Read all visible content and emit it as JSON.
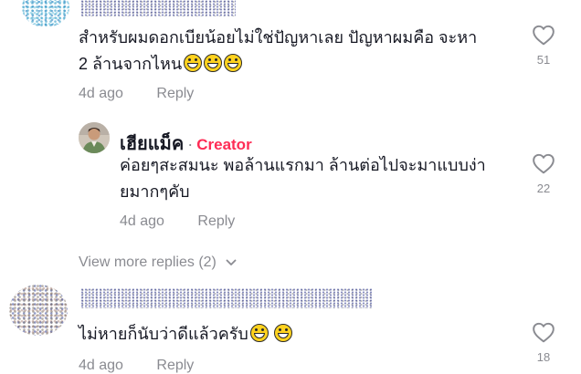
{
  "comments": [
    {
      "text_line1": "สำหรับผมดอกเบียน้อยไม่ใช่ปัญหาเลย ปัญหาผมคือ จะหา",
      "text_line2": "2 ล้านจากไหน",
      "emoji_count": 3,
      "time": "4d ago",
      "reply_label": "Reply",
      "likes": "51"
    },
    {
      "text_line1": "ไม่หายก็นับว่าดีแล้วครับ",
      "emoji_count": 2,
      "time": "4d ago",
      "reply_label": "Reply",
      "likes": "18"
    }
  ],
  "reply": {
    "author": "เฮียแม็ค",
    "separator": "·",
    "badge": "Creator",
    "text_line1": "ค่อยๆสะสมนะ พอล้านแรกมา ล้านต่อไปจะมาแบบง่า",
    "text_line2": "ยมากๆคับ",
    "time": "4d ago",
    "reply_label": "Reply",
    "likes": "22"
  },
  "view_more": "View more replies (2)",
  "colors": {
    "text": "#161823",
    "muted": "#8a8b91",
    "creator_badge": "#fe2c55",
    "emoji": "#ffd21e"
  },
  "icons": [
    "heart-outline-icon",
    "chevron-down-icon",
    "grinning-emoji"
  ]
}
